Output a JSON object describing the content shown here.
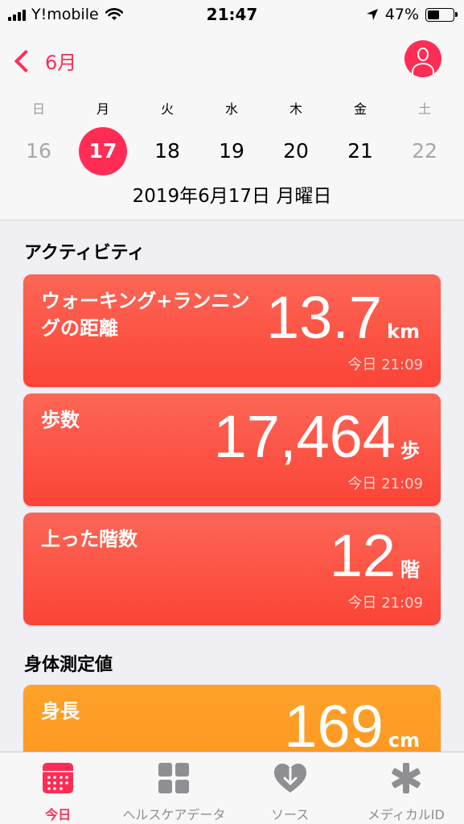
{
  "status": {
    "carrier": "Y!mobile",
    "time": "21:47",
    "battery": "47%",
    "battery_level": 0.47
  },
  "header": {
    "back_label": "6月",
    "weekdays": [
      "日",
      "月",
      "火",
      "水",
      "木",
      "金",
      "土"
    ],
    "days": [
      "16",
      "17",
      "18",
      "19",
      "20",
      "21",
      "22"
    ],
    "selected_index": 1,
    "date_full": "2019年6月17日 月曜日"
  },
  "activity": {
    "title": "アクティビティ",
    "cards": [
      {
        "label": "ウォーキング+ランニングの距離",
        "value": "13.7",
        "unit": "km",
        "time": "今日 21:09"
      },
      {
        "label": "歩数",
        "value": "17,464",
        "unit": "歩",
        "time": "今日 21:09"
      },
      {
        "label": "上った階数",
        "value": "12",
        "unit": "階",
        "time": "今日 21:09"
      }
    ]
  },
  "body_measurements": {
    "title": "身体測定値",
    "cards": [
      {
        "label": "身長",
        "value": "169",
        "unit": "cm"
      }
    ]
  },
  "tabs": [
    {
      "label": "今日",
      "icon": "calendar-icon",
      "active": true
    },
    {
      "label": "ヘルスケアデータ",
      "icon": "grid-icon",
      "active": false
    },
    {
      "label": "ソース",
      "icon": "heart-arrow-icon",
      "active": false
    },
    {
      "label": "メディカルID",
      "icon": "asterisk-icon",
      "active": false
    }
  ],
  "colors": {
    "accent": "#ff2d55",
    "activity_card": "#fb4d3e",
    "body_card": "#fd9b24",
    "inactive": "#8e8e93"
  }
}
